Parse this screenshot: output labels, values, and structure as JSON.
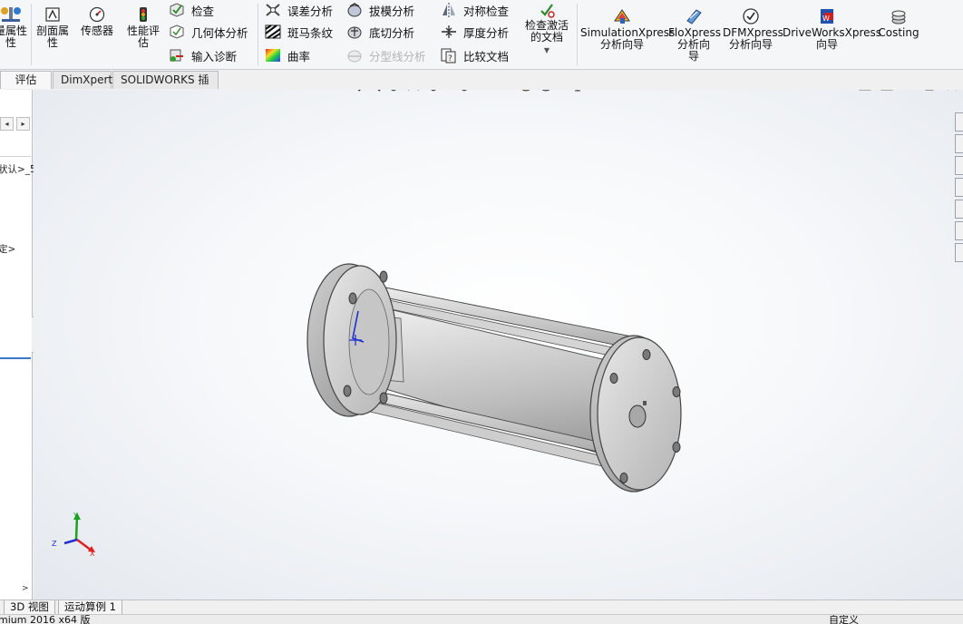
{
  "ribbon": {
    "mass_props": "量属性",
    "mass_props_line2": "性",
    "section_props": "剖面属",
    "section_props_line2": "性",
    "sensor": "传感器",
    "perf": "性能评",
    "perf_line2": "估",
    "check": "检查",
    "geometry": "几何体分析",
    "import_diag": "输入诊断",
    "deviation": "误差分析",
    "zebra": "斑马条纹",
    "curvature": "曲率",
    "draft": "拔模分析",
    "undercut": "底切分析",
    "parting": "分型线分析",
    "symmetry": "对称检查",
    "thickness": "厚度分析",
    "compare": "比较文档",
    "check_active": "检查激活",
    "check_active_line2": "的文档",
    "simxpress": "SimulationXpress",
    "simxpress_line2": "分析向导",
    "floxpress": "FloXpress",
    "floxpress_line2": "分析向",
    "floxpress_line3": "导",
    "dfmxpress": "DFMXpress",
    "dfmxpress_line2": "分析向导",
    "driveworks": "DriveWorksXpress",
    "driveworks_line2": "向导",
    "costing": "Costing"
  },
  "tabs": [
    "评估",
    "DimXpert",
    "SOLIDWORKS 插件"
  ],
  "left_panel": {
    "item1": "状认>_5",
    "item2": "定>"
  },
  "bottom_tabs": [
    "3D 视图",
    "运动算例 1"
  ],
  "status": {
    "left": "mium 2016 x64 版",
    "right": "自定义"
  },
  "colors": {
    "ribbon_bg": "#f5f6f7",
    "viewport_bg": "#f3f5f8",
    "model_gray": "#c8c8c8",
    "axis_x": "#e02020",
    "axis_y": "#20a020",
    "axis_z": "#2030d0"
  }
}
